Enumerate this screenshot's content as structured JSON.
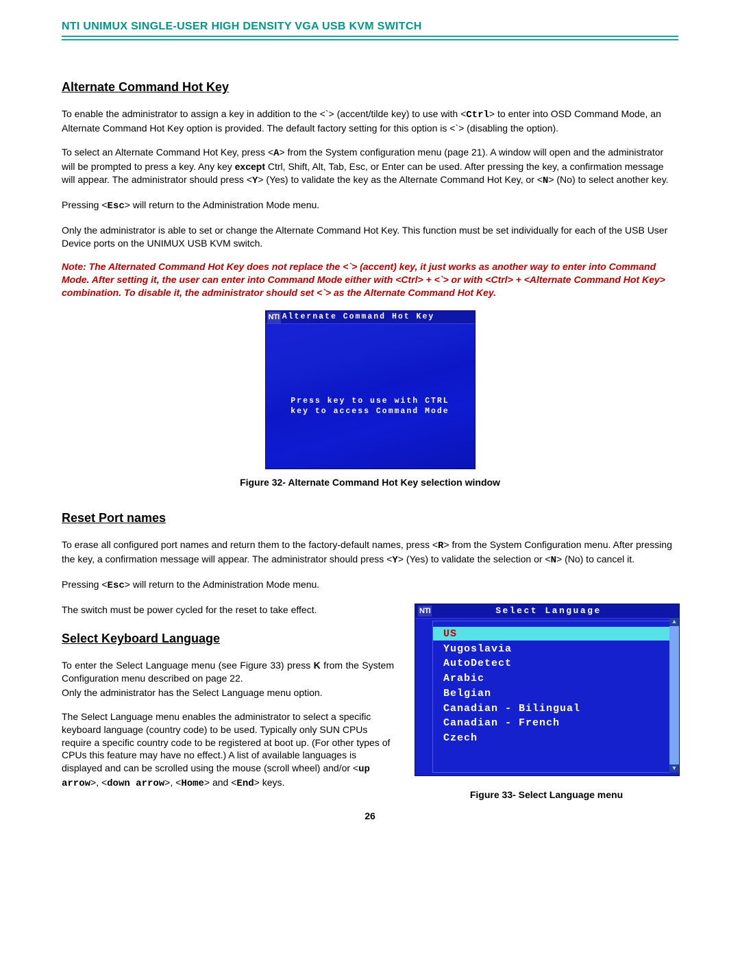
{
  "header": {
    "title": "NTI UNIMUX SINGLE-USER HIGH DENSITY VGA USB KVM SWITCH"
  },
  "section1": {
    "heading": "Alternate Command Hot Key",
    "p1_a": "To enable the administrator to assign a key in addition to the <`> (accent/tilde key) to use with <",
    "ctrl": "Ctrl",
    "p1_b": "> to enter into OSD Command Mode, an Alternate Command Hot Key option is provided.  The default factory setting for this option is <`> (disabling the option).",
    "p2_a": "To select an Alternate Command Hot Key, press <",
    "A": "A",
    "p2_b": "> from the System configuration menu (page 21).  A window will open and the administrator will be prompted to press a key.  Any key ",
    "except": "except",
    "p2_c": " Ctrl, Shift, Alt, Tab, Esc, or Enter can be used.   After pressing the key, a confirmation message will appear.  The administrator should press <",
    "Y": "Y",
    "p2_d": "> (Yes) to validate the key as the Alternate Command Hot Key, or <",
    "N": "N",
    "p2_e": "> (No) to select another key.",
    "p3_a": "Pressing <",
    "Esc": "Esc",
    "p3_b": "> will return to the Administration Mode menu.",
    "p4": "Only the administrator is able to set or change the Alternate Command Hot Key. This function must be set individually for each of the USB User Device ports on the UNIMUX USB KVM switch.",
    "note": "Note: The Alternated Command Hot Key does not replace the <`> (accent) key, it just works as another way to enter into Command Mode. After setting it, the user can enter into Command Mode either with <Ctrl> + <`> or with <Ctrl> + <Alternate Command Hot Key> combination. To disable it, the administrator should set <`> as the Alternate Command Hot Key."
  },
  "fig32": {
    "logo": "NTI",
    "title": "Alternate Command Hot Key",
    "line1": "Press key to use with CTRL",
    "line2": "key to access Command Mode",
    "caption": "Figure 32- Alternate Command Hot Key selection window"
  },
  "section2": {
    "heading": "Reset Port names",
    "p1_a": "To erase all configured port names and return them to the factory-default names, press <",
    "R": "R",
    "p1_b": "> from the System Configuration menu.  After pressing the key, a confirmation message will appear.  The administrator should press <",
    "Y": "Y",
    "p1_c": "> (Yes) to validate the selection or <",
    "N": "N",
    "p1_d": "> (No) to cancel it.",
    "p2_a": "Pressing <",
    "Esc": "Esc",
    "p2_b": "> will return to the Administration Mode menu.",
    "p3": "The switch must be power cycled for the reset to take effect."
  },
  "section3": {
    "heading": "Select Keyboard Language",
    "p1_a": "To enter the Select Language menu (see Figure 33) press ",
    "K": "K",
    "p1_b": " from the System Configuration menu described on page 22.",
    "p2": "Only the administrator has the Select Language menu option.",
    "p3_a": "The Select Language menu enables the administrator to select a specific keyboard language (country code) to be used.   Typically only SUN CPUs require a specific country code to be registered at boot up. (For other types of CPUs this feature may have no effect.) A list of available languages is displayed and can be scrolled using the mouse (scroll wheel) and/or <",
    "up": "up arrow",
    "p3_b": ">, <",
    "down": "down arrow",
    "p3_c": ">, <",
    "home": "Home",
    "p3_d": "> and <",
    "end": "End",
    "p3_e": "> keys."
  },
  "fig33": {
    "logo": "NTI",
    "title": "Select Language",
    "items": [
      "US",
      "Yugoslavia",
      "AutoDetect",
      "Arabic",
      "Belgian",
      "Canadian - Bilingual",
      "Canadian - French",
      "Czech"
    ],
    "caption": "Figure 33- Select Language menu"
  },
  "footer": {
    "page": "26"
  }
}
